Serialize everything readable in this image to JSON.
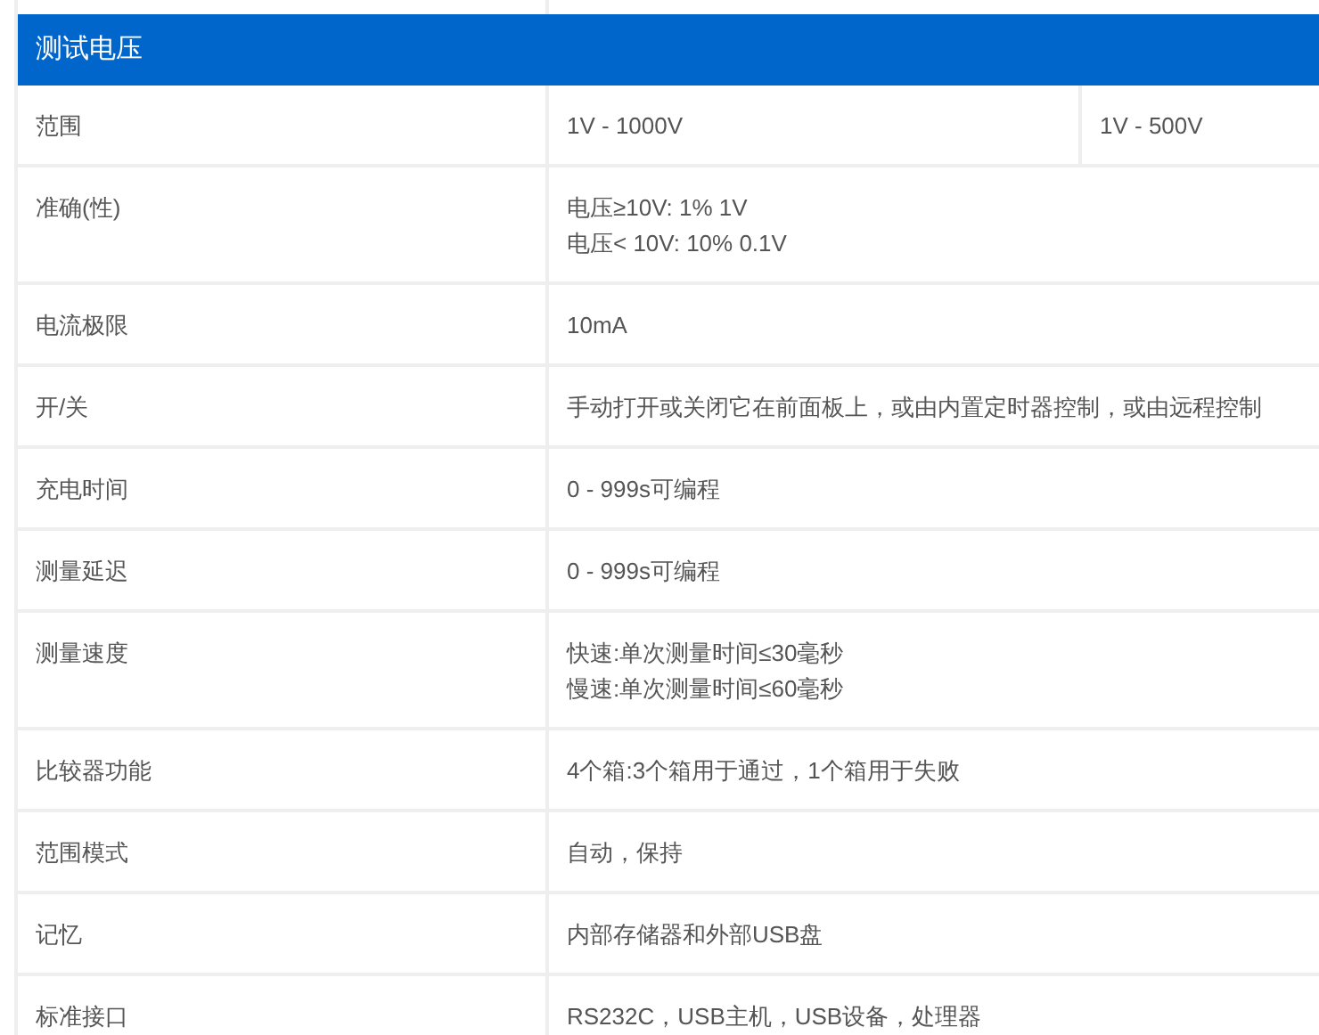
{
  "header": "测试电压",
  "rows": [
    {
      "label": "范围",
      "values": [
        [
          "1V - 1000V"
        ],
        [
          "1V - 500V"
        ]
      ]
    },
    {
      "label": "准确(性)",
      "values": [
        [
          "电压≥10V: 1% 1V",
          "电压< 10V: 10% 0.1V"
        ]
      ]
    },
    {
      "label": "电流极限",
      "values": [
        [
          "10mA"
        ]
      ]
    },
    {
      "label": "开/关",
      "values": [
        [
          "手动打开或关闭它在前面板上，或由内置定时器控制，或由远程控制"
        ]
      ]
    },
    {
      "label": "充电时间",
      "values": [
        [
          "0 - 999s可编程"
        ]
      ]
    },
    {
      "label": "测量延迟",
      "values": [
        [
          "0 - 999s可编程"
        ]
      ]
    },
    {
      "label": "测量速度",
      "values": [
        [
          "快速:单次测量时间≤30毫秒",
          "慢速:单次测量时间≤60毫秒"
        ]
      ]
    },
    {
      "label": "比较器功能",
      "values": [
        [
          "4个箱:3个箱用于通过，1个箱用于失败"
        ]
      ]
    },
    {
      "label": "范围模式",
      "values": [
        [
          "自动，保持"
        ]
      ]
    },
    {
      "label": "记忆",
      "values": [
        [
          "内部存储器和外部USB盘"
        ]
      ]
    },
    {
      "label": "标准接口",
      "values": [
        [
          "RS232C，USB主机，USB设备，处理器"
        ]
      ]
    }
  ]
}
